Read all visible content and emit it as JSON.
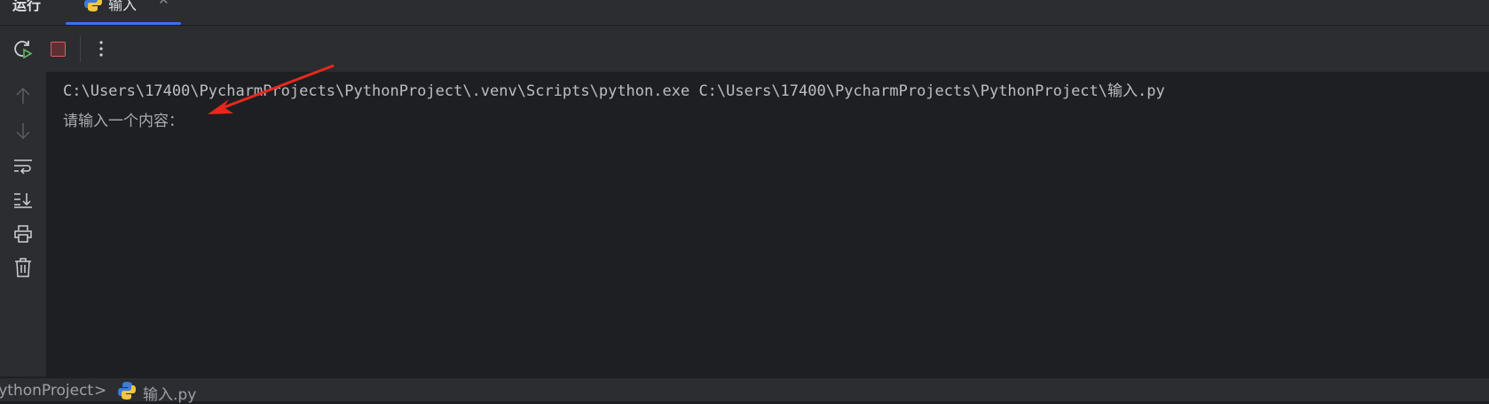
{
  "tabs": {
    "run_label": "运行",
    "file_tab_label": "输入"
  },
  "console": {
    "lines": [
      "C:\\Users\\17400\\PycharmProjects\\PythonProject\\.venv\\Scripts\\python.exe C:\\Users\\17400\\PycharmProjects\\PythonProject\\输入.py",
      "请输入一个内容："
    ]
  },
  "statusbar": {
    "project": "PythonProject",
    "separator": ">",
    "file": "输入.py"
  },
  "colors": {
    "accent": "#3574f0",
    "annotation_arrow": "#e8281e",
    "stop": "#db5c5c",
    "rerun": "#5fb865"
  }
}
